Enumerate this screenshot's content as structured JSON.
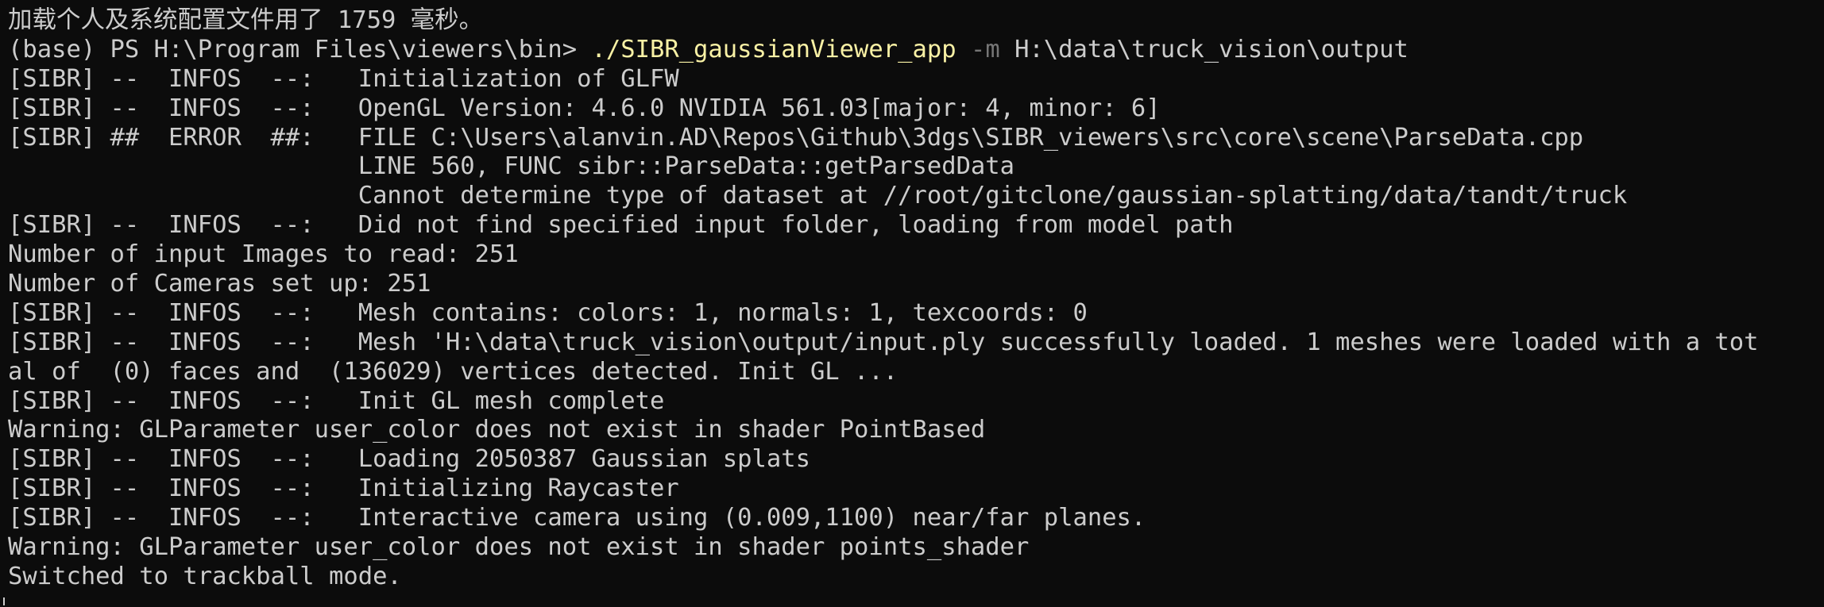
{
  "terminal": {
    "lines": [
      "加载个人及系统配置文件用了 1759 毫秒。",
      "",
      "[SIBR] --  INFOS  --:   Initialization of GLFW",
      "[SIBR] --  INFOS  --:   OpenGL Version: 4.6.0 NVIDIA 561.03[major: 4, minor: 6]",
      "[SIBR] ##  ERROR  ##:   FILE C:\\Users\\alanvin.AD\\Repos\\Github\\3dgs\\SIBR_viewers\\src\\core\\scene\\ParseData.cpp",
      "                        LINE 560, FUNC sibr::ParseData::getParsedData",
      "                        Cannot determine type of dataset at //root/gitclone/gaussian-splatting/data/tandt/truck",
      "[SIBR] --  INFOS  --:   Did not find specified input folder, loading from model path",
      "Number of input Images to read: 251",
      "Number of Cameras set up: 251",
      "[SIBR] --  INFOS  --:   Mesh contains: colors: 1, normals: 1, texcoords: 0",
      "[SIBR] --  INFOS  --:   Mesh 'H:\\data\\truck_vision\\output/input.ply successfully loaded. 1 meshes were loaded with a tot",
      "al of  (0) faces and  (136029) vertices detected. Init GL ...",
      "[SIBR] --  INFOS  --:   Init GL mesh complete",
      "Warning: GLParameter user_color does not exist in shader PointBased",
      "[SIBR] --  INFOS  --:   Loading 2050387 Gaussian splats",
      "[SIBR] --  INFOS  --:   Initializing Raycaster",
      "[SIBR] --  INFOS  --:   Interactive camera using (0.009,1100) near/far planes.",
      "Warning: GLParameter user_color does not exist in shader points_shader",
      "Switched to trackball mode."
    ],
    "prompt": {
      "prefix": "(base) PS H:\\Program Files\\viewers\\bin> ",
      "executable": "./SIBR_gaussianViewer_app",
      "flag": "-m",
      "argument": " H:\\data\\truck_vision\\output"
    }
  },
  "colors": {
    "background": "#0c0c0c",
    "foreground": "#cccccc",
    "command": "#f9f1a5",
    "parameter": "#767676"
  }
}
